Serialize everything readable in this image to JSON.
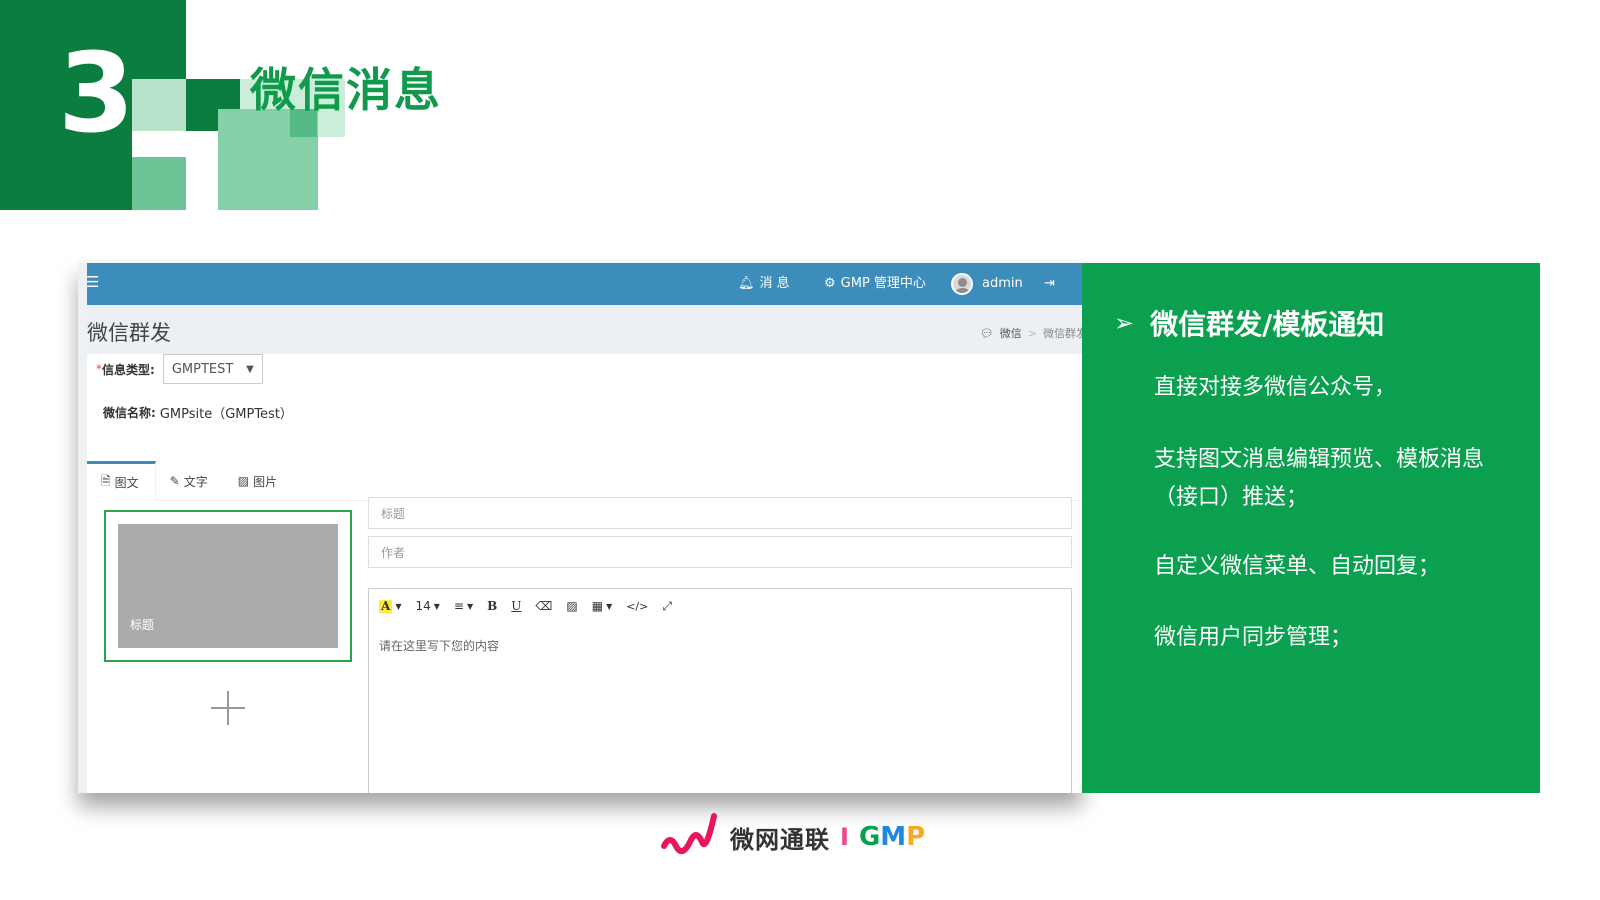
{
  "section": {
    "number": "3",
    "title": "微信消息"
  },
  "app": {
    "topbar": {
      "menu_icon": "hamburger-icon",
      "notifications_label": "消 息",
      "gmp_center_label": "GMP 管理中心",
      "user_name": "admin",
      "logout_icon": "logout-icon",
      "background_color": "#3c8dbc"
    },
    "page_title": "微信群发",
    "breadcrumb": [
      "微信",
      "微信群发"
    ],
    "form": {
      "required_mark": "*",
      "type_label": "信息类型:",
      "type_value": "GMPTEST",
      "wechat_name_label": "微信名称:",
      "wechat_name_value": "GMPsite（GMPTest）"
    },
    "tabs": [
      {
        "label": "图文",
        "icon": "document-icon",
        "active": true
      },
      {
        "label": "文字",
        "icon": "pencil-icon",
        "active": false
      },
      {
        "label": "图片",
        "icon": "image-icon",
        "active": false
      }
    ],
    "cover_caption": "标题",
    "title_placeholder": "标题",
    "author_placeholder": "作者",
    "editor": {
      "font_size": "14",
      "placeholder": "请在这里写下您的内容",
      "bold_label": "B",
      "underline_label": "U",
      "color_label": "A",
      "code_label": "</>"
    }
  },
  "info_panel": {
    "heading": "微信群发/模板通知",
    "items": [
      "直接对接多微信公众号，",
      "支持图文消息编辑预览、模板消息（接口）推送；",
      "自定义微信菜单、自动回复；",
      "微信用户同步管理；"
    ],
    "background_color": "#0ba050"
  },
  "footer_logo": {
    "name": "微网通联",
    "bar": "I",
    "g": "G",
    "m": "M",
    "p": "P"
  }
}
